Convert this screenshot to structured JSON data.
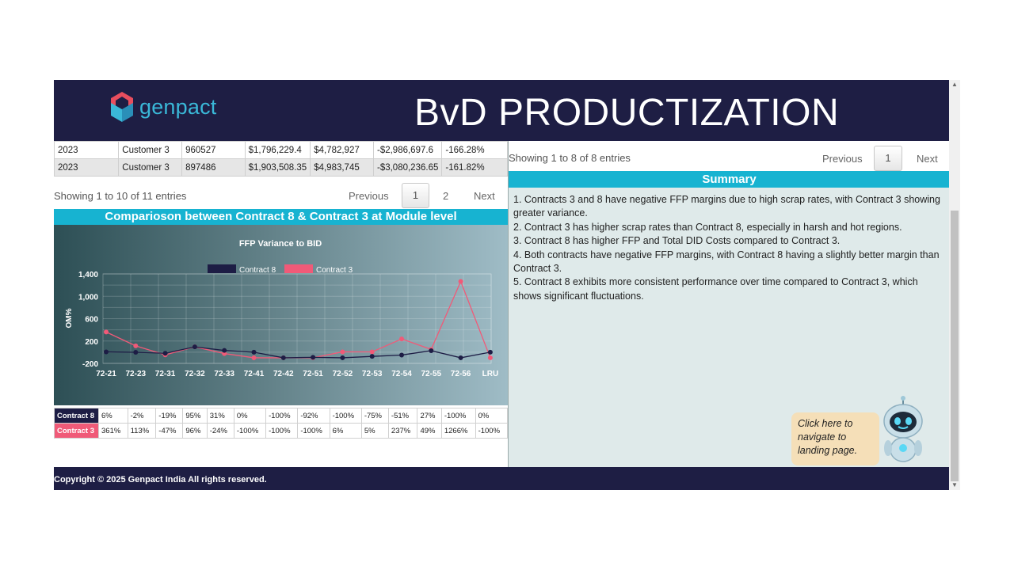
{
  "header": {
    "logo_text": "genpact",
    "title": "BvD PRODUCTIZATION"
  },
  "top_table": {
    "rows": [
      [
        "2023",
        "Customer 3",
        "960527",
        "$1,796,229.4",
        "$4,782,927",
        "-$2,986,697.6",
        "-166.28%"
      ],
      [
        "2023",
        "Customer 3",
        "897486",
        "$1,903,508.35",
        "$4,983,745",
        "-$3,080,236.65",
        "-161.82%"
      ]
    ]
  },
  "left_pager": {
    "info": "Showing 1 to 10 of 11 entries",
    "previous": "Previous",
    "page1": "1",
    "page2": "2",
    "next": "Next"
  },
  "comparison_title": "Comparioson between Contract 8 & Contract 3 at Module level",
  "chart_data": {
    "type": "line",
    "title": "FFP Variance to BID",
    "ylabel": "OM%",
    "xlabel": "",
    "categories": [
      "72-21",
      "72-23",
      "72-31",
      "72-32",
      "72-33",
      "72-41",
      "72-42",
      "72-51",
      "72-52",
      "72-53",
      "72-54",
      "72-55",
      "72-56",
      "LRU"
    ],
    "yticks": [
      "1,400",
      "1,000",
      "600",
      "200",
      "-200"
    ],
    "ylim": [
      -200,
      1400
    ],
    "legend_position": "top-center",
    "grid": true,
    "series": [
      {
        "name": "Contract 8",
        "color": "#1d1d45",
        "values": [
          6,
          -2,
          -19,
          95,
          31,
          0,
          -100,
          -92,
          -100,
          -75,
          -51,
          27,
          -100,
          0
        ]
      },
      {
        "name": "Contract 3",
        "color": "#f05a78",
        "values": [
          361,
          113,
          -47,
          96,
          -24,
          -100,
          -100,
          -100,
          6,
          5,
          237,
          49,
          1266,
          -100
        ]
      }
    ]
  },
  "values_table": {
    "rows": [
      {
        "label": "Contract 8",
        "color": "#1d1d45",
        "cells": [
          "6%",
          "-2%",
          "-19%",
          "95%",
          "31%",
          "0%",
          "-100%",
          "-92%",
          "-100%",
          "-75%",
          "-51%",
          "27%",
          "-100%",
          "0%"
        ]
      },
      {
        "label": "Contract 3",
        "color": "#f05a78",
        "cells": [
          "361%",
          "113%",
          "-47%",
          "96%",
          "-24%",
          "-100%",
          "-100%",
          "-100%",
          "6%",
          "5%",
          "237%",
          "49%",
          "1266%",
          "-100%"
        ]
      }
    ]
  },
  "right_pager": {
    "info": "Showing 1 to 8 of 8 entries",
    "previous": "Previous",
    "page1": "1",
    "next": "Next"
  },
  "summary": {
    "title": "Summary",
    "items": [
      "1. Contracts 3 and 8 have negative FFP margins due to high scrap rates, with Contract 3 showing greater variance.",
      "2. Contract 3 has higher scrap rates than Contract 8, especially in harsh and hot regions.",
      "3. Contract 8 has higher FFP and Total DID Costs compared to Contract 3.",
      "4. Both contracts have negative FFP margins, with Contract 8 having a slightly better margin than Contract 3.",
      "5. Contract 8 exhibits more consistent performance over time compared to Contract 3, which shows significant fluctuations."
    ]
  },
  "bot": {
    "bubble_text": "Click here to navigate to landing page.",
    "icon": "robot-icon"
  },
  "footer": {
    "copyright": "Copyright © 2025 Genpact India All rights reserved."
  }
}
